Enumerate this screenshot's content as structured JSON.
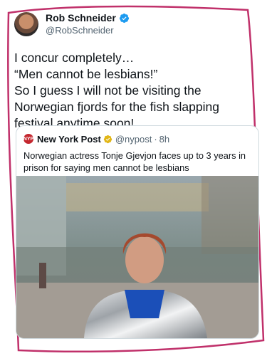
{
  "tweet": {
    "display_name": "Rob Schneider",
    "handle": "@RobSchneider",
    "text": "I concur completely…\n“Men cannot be lesbians!”\nSo I guess I will not be visiting the Norwegian fjords for the fish slapping festival anytime soon!"
  },
  "quote": {
    "logo_text": "NYP",
    "display_name": "New York Post",
    "handle": "@nypost",
    "separator": "·",
    "time": "8h",
    "text": "Norwegian actress Tonje Gjevjon faces up to 3 years in prison for saying men cannot be lesbians trib.al/myGdsWW"
  },
  "colors": {
    "frame": "#c0306a",
    "verified": "#1d9bf0",
    "gold_verified": "#e2b719",
    "nyp_red": "#c4262e"
  },
  "icons": {
    "verified": "verified-badge-icon",
    "gold_verified": "gold-verified-badge-icon"
  }
}
